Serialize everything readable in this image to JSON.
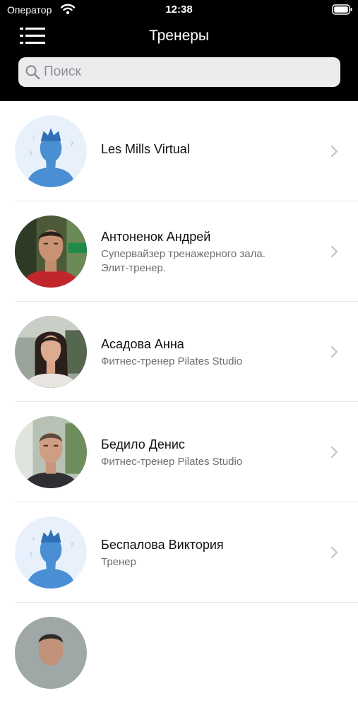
{
  "status_bar": {
    "carrier": "Оператор",
    "time": "12:38"
  },
  "header": {
    "title": "Тренеры"
  },
  "search": {
    "placeholder": "Поиск"
  },
  "trainers": [
    {
      "name": "Les Mills Virtual",
      "subtitle": "",
      "avatar": "placeholder-avatar"
    },
    {
      "name": "Антоненок Андрей",
      "subtitle": "Супервайзер тренажерного зала.",
      "subtitle2": "Элит-тренер.",
      "avatar": "photo"
    },
    {
      "name": "Асадова Анна",
      "subtitle": "Фитнес-тренер Pilates Studio",
      "avatar": "photo"
    },
    {
      "name": "Бедило Денис",
      "subtitle": "Фитнес-тренер Pilates Studio",
      "avatar": "photo"
    },
    {
      "name": "Беспалова Виктория",
      "subtitle": "Тренер",
      "avatar": "placeholder-avatar"
    }
  ],
  "colors": {
    "header_bg": "#000000",
    "placeholder_blue": "#4a8fd4",
    "separator": "#e4e4e7"
  }
}
